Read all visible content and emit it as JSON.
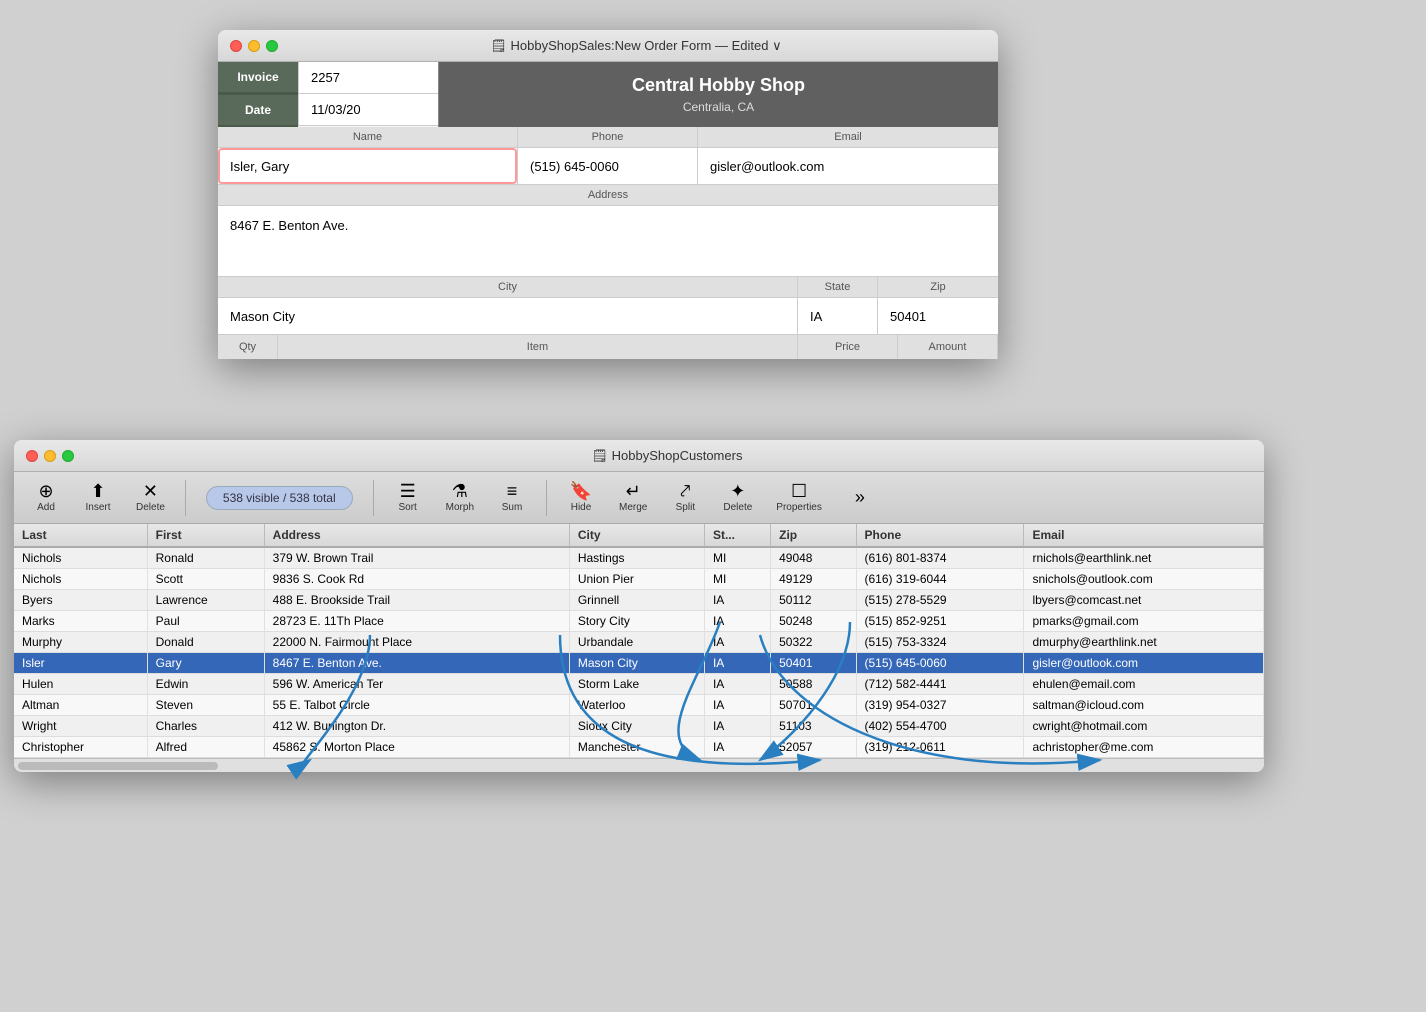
{
  "orderWindow": {
    "title": "HobbyShopSales:New Order Form — Edited ∨",
    "invoice": {
      "label": "Invoice",
      "value": "2257"
    },
    "date": {
      "label": "Date",
      "value": "11/03/20"
    },
    "shop": {
      "name": "Central Hobby Shop",
      "location": "Centralia, CA"
    },
    "fields": {
      "name_label": "Name",
      "phone_label": "Phone",
      "email_label": "Email",
      "address_label": "Address",
      "city_label": "City",
      "state_label": "State",
      "zip_label": "Zip",
      "name_value": "Isler, Gary",
      "phone_value": "(515) 645-0060",
      "email_value": "gisler@outlook.com",
      "address_value": "8467 E. Benton Ave.",
      "city_value": "Mason City",
      "state_value": "IA",
      "zip_value": "50401"
    },
    "items": {
      "qty_label": "Qty",
      "item_label": "Item",
      "price_label": "Price",
      "amount_label": "Amount"
    }
  },
  "customersWindow": {
    "title": "HobbyShopCustomers",
    "recordCount": "538 visible / 538 total",
    "toolbar": {
      "add": "Add",
      "insert": "Insert",
      "delete": "Delete",
      "sort": "Sort",
      "morph": "Morph",
      "sum": "Sum",
      "hide": "Hide",
      "merge": "Merge",
      "split": "Split",
      "delete2": "Delete",
      "properties": "Properties"
    },
    "columns": [
      "Last",
      "First",
      "Address",
      "City",
      "St...",
      "Zip",
      "Phone",
      "Email"
    ],
    "rows": [
      {
        "last": "Nichols",
        "first": "Ronald",
        "address": "379 W. Brown Trail",
        "city": "Hastings",
        "state": "MI",
        "zip": "49048",
        "phone": "(616) 801-8374",
        "email": "rnichols@earthlink.net",
        "selected": false
      },
      {
        "last": "Nichols",
        "first": "Scott",
        "address": "9836 S. Cook Rd",
        "city": "Union Pier",
        "state": "MI",
        "zip": "49129",
        "phone": "(616) 319-6044",
        "email": "snichols@outlook.com",
        "selected": false
      },
      {
        "last": "Byers",
        "first": "Lawrence",
        "address": "488 E. Brookside Trail",
        "city": "Grinnell",
        "state": "IA",
        "zip": "50112",
        "phone": "(515) 278-5529",
        "email": "lbyers@comcast.net",
        "selected": false
      },
      {
        "last": "Marks",
        "first": "Paul",
        "address": "28723 E. 11Th Place",
        "city": "Story City",
        "state": "IA",
        "zip": "50248",
        "phone": "(515) 852-9251",
        "email": "pmarks@gmail.com",
        "selected": false
      },
      {
        "last": "Murphy",
        "first": "Donald",
        "address": "22000 N. Fairmount Place",
        "city": "Urbandale",
        "state": "IA",
        "zip": "50322",
        "phone": "(515) 753-3324",
        "email": "dmurphy@earthlink.net",
        "selected": false
      },
      {
        "last": "Isler",
        "first": "Gary",
        "address": "8467 E. Benton Ave.",
        "city": "Mason City",
        "state": "IA",
        "zip": "50401",
        "phone": "(515) 645-0060",
        "email": "gisler@outlook.com",
        "selected": true
      },
      {
        "last": "Hulen",
        "first": "Edwin",
        "address": "596 W. American Ter",
        "city": "Storm Lake",
        "state": "IA",
        "zip": "50588",
        "phone": "(712) 582-4441",
        "email": "ehulen@email.com",
        "selected": false
      },
      {
        "last": "Altman",
        "first": "Steven",
        "address": "55 E. Talbot Circle",
        "city": "Waterloo",
        "state": "IA",
        "zip": "50701",
        "phone": "(319) 954-0327",
        "email": "saltman@icloud.com",
        "selected": false
      },
      {
        "last": "Wright",
        "first": "Charles",
        "address": "412 W. Burlington Dr.",
        "city": "Sioux City",
        "state": "IA",
        "zip": "51103",
        "phone": "(402) 554-4700",
        "email": "cwright@hotmail.com",
        "selected": false
      },
      {
        "last": "Christopher",
        "first": "Alfred",
        "address": "45862 S. Morton Place",
        "city": "Manchester",
        "state": "IA",
        "zip": "52057",
        "phone": "(319) 212-0611",
        "email": "achristopher@me.com",
        "selected": false
      }
    ]
  }
}
